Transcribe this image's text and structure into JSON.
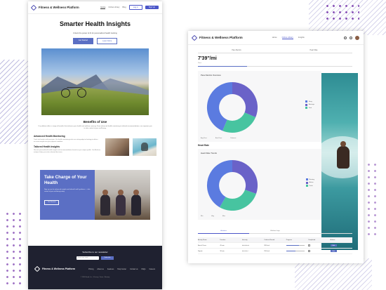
{
  "colors": {
    "accent": "#5b6fc4",
    "donut_blue": "#5b7be0",
    "donut_green": "#47c4a0",
    "donut_purple": "#6a62c8",
    "dark_footer": "#1f2130"
  },
  "landing": {
    "brand": "Fitness & Wellness Platform",
    "nav": [
      "Home",
      "Online Library",
      "Blog"
    ],
    "login": "Log in",
    "signup": "Sign Up",
    "hero_title": "Smarter Health Insights",
    "hero_sub": "Unlock the power of AI for personalized health tracking",
    "hero_btn_primary": "Get Started",
    "hero_btn_secondary": "Learn More",
    "benefits_title": "Benefits of Use",
    "benefits_text": "Our platform offers a range of benefits that enhance your health and wellness journey. From advanced health monitoring to tailored recommendations, we empower you to take control of your well-being.",
    "feature1_title": "Advanced Health Monitoring",
    "feature1_text": "Track vital metrics with precision. Our health monitoring tools use cutting-edge technology to deliver accurate insights into your physical condition.",
    "feature2_title": "Tailored Health Insights",
    "feature2_text": "Receive personalized health insights and recommendations based on your unique profile. Our AI-driven analysis helps you make informed decisions.",
    "cta_title": "Take Charge of Your Health",
    "cta_text": "Sign up now for advanced insights and tailored health guidance — take control of your well-being today.",
    "cta_btn": "Get Started",
    "newsletter_title": "Subscribe to our newsletter",
    "newsletter_placeholder": "Enter your email",
    "newsletter_btn": "Subscribe",
    "footer_brand": "Fitness & Wellness Platform",
    "footer_links": [
      "Pricing",
      "About us",
      "Features",
      "Help Center",
      "Contact us",
      "FAQs",
      "Careers"
    ],
    "copyright": "© 2024 Brand, Inc. • Privacy • Terms • Sitemap"
  },
  "dashboard": {
    "brand": "Fitness & Wellness Platform",
    "nav": [
      "Home",
      "Online Library",
      "Insights"
    ],
    "stat_tabs": [
      "Pace Metrics",
      "Heart Rate"
    ],
    "pace_value": "7'39\"/mi",
    "pace_label": "Pace",
    "pace_progress": 0.32,
    "card1_title": "Pace Metrics Overview",
    "card1_legend": [
      "Easy",
      "Average",
      "Fast"
    ],
    "card1_stats": [
      "Avg Pace",
      "Best Pace",
      "Distance"
    ],
    "section_title": "Heart Rate",
    "card2_title": "Heart Rate Trends",
    "card2_legend": [
      "Resting",
      "Active",
      "Peak"
    ],
    "card2_stats": [
      "Min",
      "Avg",
      "Max"
    ],
    "table_tabs": [
      "Activities",
      "Workout Logs",
      "Goals"
    ],
    "table_headers": [
      "Activity Name",
      "Duration",
      "Intensity",
      "Calories Burned",
      "Progress",
      "Completed",
      "Actions"
    ],
    "table_rows": [
      {
        "name": "Bench Press",
        "duration": "45 min",
        "stars": "★★★★★",
        "calories": "320 kcal",
        "progress": 0.7,
        "action": "Edit"
      },
      {
        "name": "Squats",
        "duration": "30 min",
        "stars": "★★★★☆",
        "calories": "250 kcal",
        "progress": 0.5,
        "action": "Edit"
      }
    ]
  }
}
